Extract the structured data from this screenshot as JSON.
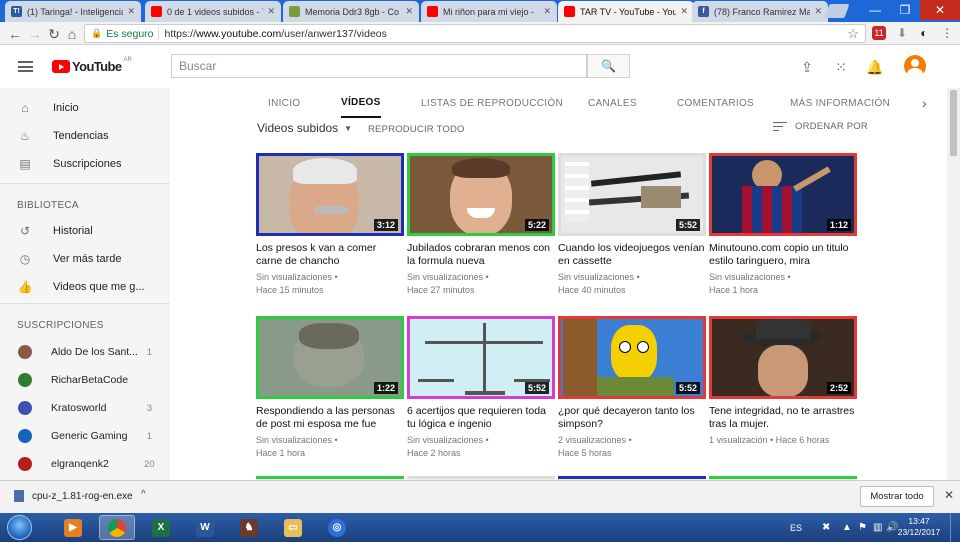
{
  "browser": {
    "tabs": [
      {
        "title": "(1) Taringa! - Inteligencia",
        "color": "#2c5aa0",
        "letter": "T!"
      },
      {
        "title": "0 de 1 videos subidos - Y",
        "color": "#ff0000",
        "letter": ""
      },
      {
        "title": "Memoria Ddr3 8gb - Co",
        "color": "#7a9c3c",
        "letter": ""
      },
      {
        "title": "Mi riñon para mi viejo -",
        "color": "#ff0000",
        "letter": ""
      },
      {
        "title": "TAR TV - YouTube - You",
        "color": "#ff0000",
        "letter": ""
      },
      {
        "title": "(78) Franco Ramirez Mar",
        "color": "#3b5998",
        "letter": "f"
      }
    ],
    "active_tab": 4,
    "secure_label": "Es seguro",
    "url_scheme": "https://",
    "url_host": "www.youtube.com",
    "url_path": "/user/anwer137/videos",
    "ext_badge": "11"
  },
  "youtube": {
    "logo_text": "YouTube",
    "region": "AR",
    "search_placeholder": "Buscar",
    "sidebar": {
      "main": [
        {
          "label": "Inicio",
          "icon": "home-icon",
          "glyph": "⌂"
        },
        {
          "label": "Tendencias",
          "icon": "flame-icon",
          "glyph": "♨"
        },
        {
          "label": "Suscripciones",
          "icon": "subscriptions-icon",
          "glyph": "▤"
        }
      ],
      "library_heading": "BIBLIOTECA",
      "library": [
        {
          "label": "Historial",
          "icon": "history-icon",
          "glyph": "↺"
        },
        {
          "label": "Ver más tarde",
          "icon": "watch-later-icon",
          "glyph": "◷"
        },
        {
          "label": "Videos que me g...",
          "icon": "thumbs-up-icon",
          "glyph": "👍"
        }
      ],
      "subs_heading": "SUSCRIPCIONES",
      "subscriptions": [
        {
          "name": "Aldo De los Sant...",
          "count": "1",
          "color": "#8a5a44"
        },
        {
          "name": "RicharBetaCode",
          "count": "",
          "color": "#2e7d32"
        },
        {
          "name": "Kratosworld",
          "count": "3",
          "color": "#3f51b5"
        },
        {
          "name": "Generic Gaming",
          "count": "1",
          "color": "#1565c0"
        },
        {
          "name": "elgranqenk2",
          "count": "20",
          "color": "#b71c1c"
        }
      ]
    },
    "channel_tabs": [
      "INICIO",
      "VÍDEOS",
      "LISTAS DE REPRODUCCIÓN",
      "CANALES",
      "COMENTARIOS",
      "MÁS INFORMACIÓN"
    ],
    "active_channel_tab": 1,
    "filter_label": "Videos subidos",
    "play_all": "REPRODUCIR TODO",
    "sort_by": "ORDENAR POR",
    "videos": [
      {
        "title": "Los presos k van a comer carne de chancho",
        "views": "Sin visualizaciones •",
        "age": "Hace 15 minutos",
        "duration": "3:12",
        "border": "#1f2fb4",
        "bg": "#c8b8a8",
        "scene": "face-gray"
      },
      {
        "title": "Jubilados cobraran menos con la formula nueva",
        "views": "Sin visualizaciones •",
        "age": "Hace 27 minutos",
        "duration": "5:22",
        "border": "#2ecc40",
        "bg": "#7a5a3a",
        "scene": "face-smile"
      },
      {
        "title": "Cuando los videojuegos venían en cassette",
        "views": "Sin visualizaciones •",
        "age": "Hace 40 minutos",
        "duration": "5:52",
        "border": "#dddddd",
        "bg": "#e8e8e8",
        "scene": "cables"
      },
      {
        "title": "Minutouno.com copio un titulo estilo taringuero, mira",
        "views": "Sin visualizaciones •",
        "age": "Hace 1 hora",
        "duration": "1:12",
        "border": "#e53935",
        "bg": "#1a2a5a",
        "scene": "soccer"
      },
      {
        "title": "Respondiendo a las personas de post mi esposa me fue",
        "views": "Sin visualizaciones •",
        "age": "Hace 1 hora",
        "duration": "1:22",
        "border": "#2ecc40",
        "bg": "#8a9a8a",
        "scene": "man-blur"
      },
      {
        "title": "6 acertijos que requieren toda tu lógica e ingenio",
        "views": "Sin visualizaciones •",
        "age": "Hace 2 horas",
        "duration": "5:52",
        "border": "#d63bd6",
        "bg": "#cfeff5",
        "scene": "scale"
      },
      {
        "title": "¿por qué decayeron tanto los simpson?",
        "views": "2 visualizaciones •",
        "age": "Hace 5 horas",
        "duration": "5:52",
        "border": "#e53935",
        "bg": "#3b7fd4",
        "scene": "simpsons"
      },
      {
        "title": "Tene integridad, no te arrastres tras la mujer.",
        "views": "1 visualización • Hace 6 horas",
        "age": "",
        "duration": "2:52",
        "border": "#e53935",
        "bg": "#3a2a20",
        "scene": "hat-man"
      }
    ]
  },
  "downloads": {
    "filename": "cpu-z_1.81-rog-en.exe",
    "show_all": "Mostrar todo"
  },
  "taskbar": {
    "language": "ES",
    "time": "13:47",
    "date": "23/12/2017"
  }
}
